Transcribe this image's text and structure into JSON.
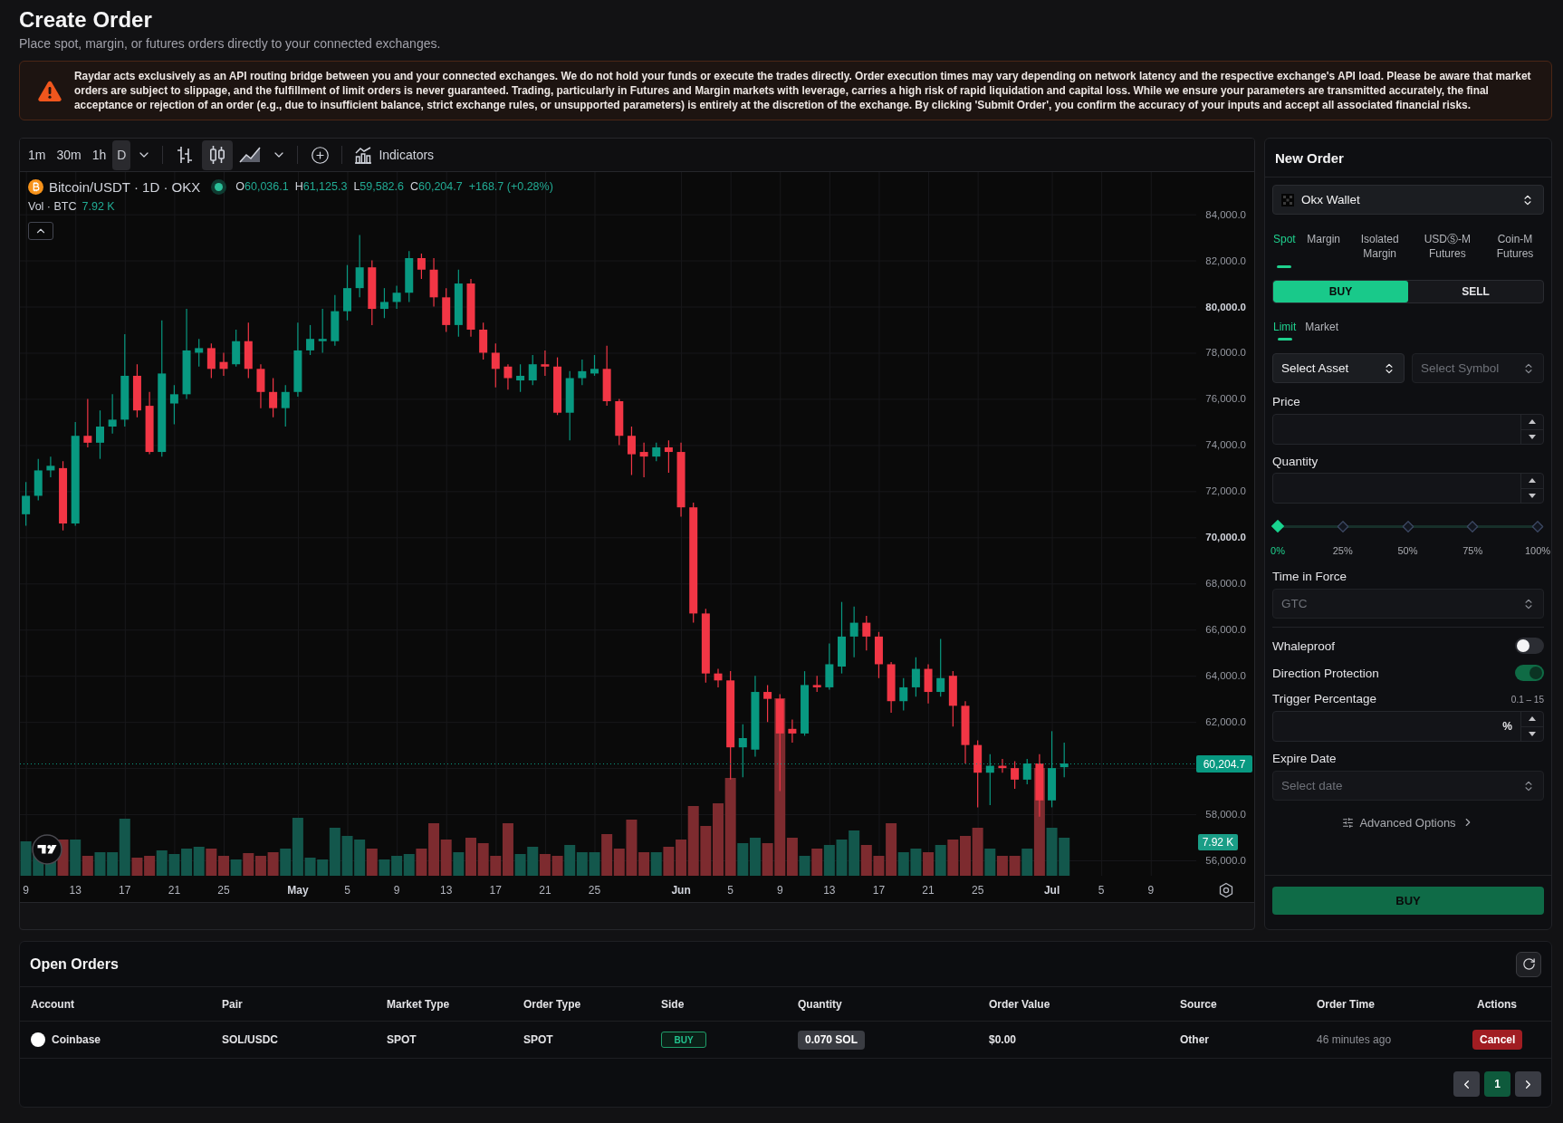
{
  "page": {
    "title": "Create Order",
    "subtitle": "Place spot, margin, or futures orders directly to your connected exchanges."
  },
  "warning": {
    "text": "Raydar acts exclusively as an API routing bridge between you and your connected exchanges. We do not hold your funds or execute the trades directly. Order execution times may vary depending on network latency and the respective exchange's API load. Please be aware that market orders are subject to slippage, and the fulfillment of limit orders is never guaranteed. Trading, particularly in Futures and Margin markets with leverage, carries a high risk of rapid liquidation and capital loss. While we ensure your parameters are transmitted accurately, the final acceptance or rejection of an order (e.g., due to insufficient balance, strict exchange rules, or unsupported parameters) is entirely at the discretion of the exchange. By clicking 'Submit Order', you confirm the accuracy of your inputs and accept all associated financial risks."
  },
  "chart": {
    "toolbar": {
      "intervals": [
        {
          "label": "1m",
          "selected": false
        },
        {
          "label": "30m",
          "selected": false
        },
        {
          "label": "1h",
          "selected": false
        },
        {
          "label": "D",
          "selected": true
        }
      ],
      "chart_types": [
        {
          "kind": "bars",
          "selected": false
        },
        {
          "kind": "candles",
          "selected": true
        },
        {
          "kind": "area",
          "selected": false
        }
      ],
      "indicators_label": "Indicators"
    },
    "legend": {
      "symbol": "Bitcoin/USDT · 1D · OKX",
      "ohlc": [
        {
          "label": "O",
          "value": "60,036.1"
        },
        {
          "label": "H",
          "value": "61,125.3"
        },
        {
          "label": "L",
          "value": "59,582.6"
        },
        {
          "label": "C",
          "value": "60,204.7"
        }
      ],
      "change": "+168.7 (+0.28%)",
      "volume_label": "Vol · BTC",
      "volume_value": "7.92 K"
    },
    "price_axis": [
      {
        "label": "84,000.0",
        "bold": false
      },
      {
        "label": "82,000.0",
        "bold": false
      },
      {
        "label": "80,000.0",
        "bold": true
      },
      {
        "label": "78,000.0",
        "bold": false
      },
      {
        "label": "76,000.0",
        "bold": false
      },
      {
        "label": "74,000.0",
        "bold": false
      },
      {
        "label": "72,000.0",
        "bold": false
      },
      {
        "label": "70,000.0",
        "bold": true
      },
      {
        "label": "68,000.0",
        "bold": false
      },
      {
        "label": "66,000.0",
        "bold": false
      },
      {
        "label": "64,000.0",
        "bold": false
      },
      {
        "label": "62,000.0",
        "bold": false
      },
      {
        "label": "58,000.0",
        "bold": false
      },
      {
        "label": "56,000.0",
        "bold": false
      }
    ],
    "date_axis": [
      {
        "label": "9",
        "bold": false
      },
      {
        "label": "13",
        "bold": false
      },
      {
        "label": "17",
        "bold": false
      },
      {
        "label": "21",
        "bold": false
      },
      {
        "label": "25",
        "bold": false
      },
      {
        "label": "May",
        "bold": true
      },
      {
        "label": "5",
        "bold": false
      },
      {
        "label": "9",
        "bold": false
      },
      {
        "label": "13",
        "bold": false
      },
      {
        "label": "17",
        "bold": false
      },
      {
        "label": "21",
        "bold": false
      },
      {
        "label": "25",
        "bold": false
      },
      {
        "label": "Jun",
        "bold": true
      },
      {
        "label": "5",
        "bold": false
      },
      {
        "label": "9",
        "bold": false
      },
      {
        "label": "13",
        "bold": false
      },
      {
        "label": "17",
        "bold": false
      },
      {
        "label": "21",
        "bold": false
      },
      {
        "label": "25",
        "bold": false
      },
      {
        "label": "Jul",
        "bold": true
      },
      {
        "label": "5",
        "bold": false
      },
      {
        "label": "9",
        "bold": false
      }
    ],
    "last_price_tag": "60,204.7",
    "volume_tag": "7.92 K"
  },
  "order_form": {
    "title": "New Order",
    "wallet": {
      "label": "Okx Wallet"
    },
    "market_tabs": [
      {
        "label": "Spot",
        "selected": true
      },
      {
        "label": "Margin",
        "selected": false
      },
      {
        "label": "Isolated Margin",
        "selected": false
      },
      {
        "label": "USDⓈ-M Futures",
        "selected": false
      },
      {
        "label": "Coin-M Futures",
        "selected": false
      }
    ],
    "sides": [
      {
        "label": "BUY",
        "selected": true
      },
      {
        "label": "SELL",
        "selected": false
      }
    ],
    "order_types": [
      {
        "label": "Limit",
        "selected": true
      },
      {
        "label": "Market",
        "selected": false
      }
    ],
    "asset_select": {
      "label": "Select Asset",
      "disabled": false
    },
    "symbol_select": {
      "placeholder": "Select Symbol",
      "disabled": true
    },
    "price": {
      "label": "Price"
    },
    "quantity": {
      "label": "Quantity"
    },
    "quantity_slider": {
      "level": 0,
      "marks": [
        "0%",
        "25%",
        "50%",
        "75%",
        "100%"
      ]
    },
    "time_in_force": {
      "label": "Time in Force",
      "value": "GTC",
      "disabled": true
    },
    "toggles": [
      {
        "label": "Whaleproof",
        "on": false
      },
      {
        "label": "Direction Protection",
        "on": true
      }
    ],
    "trigger": {
      "label": "Trigger Percentage",
      "range": "0.1 – 15",
      "unit": "%"
    },
    "expire_date": {
      "label": "Expire Date",
      "placeholder": "Select date"
    },
    "advanced_options": "Advanced Options",
    "submit": "BUY"
  },
  "open_orders": {
    "title": "Open Orders",
    "columns": [
      "Account",
      "Pair",
      "Market Type",
      "Order Type",
      "Side",
      "Quantity",
      "Order Value",
      "Source",
      "Order Time",
      "Actions"
    ],
    "rows": [
      {
        "account": "Coinbase",
        "pair": "SOL/USDC",
        "market_type": "SPOT",
        "order_type": "SPOT",
        "side": "BUY",
        "quantity": "0.070 SOL",
        "order_value": "$0.00",
        "source": "Other",
        "order_time": "46 minutes ago",
        "action": "Cancel"
      }
    ],
    "pages": [
      {
        "label": "1",
        "selected": true
      }
    ]
  }
}
